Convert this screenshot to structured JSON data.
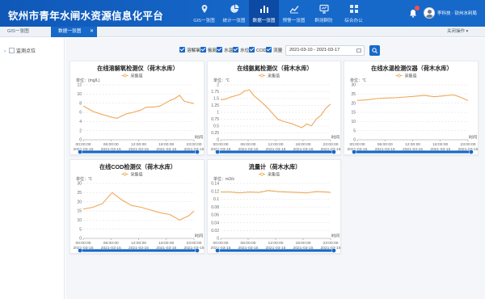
{
  "header": {
    "title": "钦州市青年水闸水资源信息化平台",
    "nav": [
      {
        "label": "GIS一张图",
        "icon": "map-pin-icon",
        "active": false
      },
      {
        "label": "统计一张图",
        "icon": "pie-chart-icon",
        "active": false
      },
      {
        "label": "数据一张图",
        "icon": "bar-chart-icon",
        "active": true
      },
      {
        "label": "预警一张图",
        "icon": "trend-line-icon",
        "active": false
      },
      {
        "label": "群测群防",
        "icon": "monitor-icon",
        "active": false
      },
      {
        "label": "综合办公",
        "icon": "grid-icon",
        "active": false
      }
    ],
    "user": "李科技 · 钦州水利局"
  },
  "tabs": [
    {
      "label": "GIS一张图",
      "active": false
    },
    {
      "label": "数据一张图",
      "active": true
    }
  ],
  "close_ops": "关闭操作 ▾",
  "sidebar": {
    "tree_label": "监测点位"
  },
  "filters": {
    "items": [
      "溶解氧",
      "氨氮",
      "水温",
      "水位",
      "COD",
      "流量"
    ],
    "date_range": "2021-03-10 - 2021-03-17"
  },
  "accent": "#1769c9",
  "series_color": "#f0a75a",
  "x_ticks": [
    "00:00:00\n2021-03-15",
    "06:00:00\n2021-03-15",
    "12:00:00\n2021-03-15",
    "18:00:00\n2021-03-15",
    "23:00:00\n2021-03-15"
  ],
  "chart_data": [
    {
      "type": "line",
      "title": "在线溶解氧检测仪（荷木水库）",
      "legend": "采集值",
      "ylabel": "单位：(mg/L)",
      "xlabel": "时间",
      "ylim": [
        0,
        12
      ],
      "yticks": [
        0,
        2,
        4,
        6,
        8,
        10,
        12
      ],
      "x": [
        0,
        2,
        4,
        6,
        7,
        9,
        10,
        12,
        13,
        15,
        16,
        17,
        18,
        19,
        20,
        21,
        23
      ],
      "y": [
        7.4,
        6.2,
        5.5,
        4.9,
        4.7,
        5.7,
        5.9,
        6.5,
        7.1,
        7.2,
        7.4,
        8.0,
        8.6,
        9.0,
        9.7,
        8.4,
        7.9
      ]
    },
    {
      "type": "line",
      "title": "在线氨氮检测仪（荷木水库）",
      "legend": "采集值",
      "ylabel": "单位：℃",
      "xlabel": "时间",
      "ylim": [
        0,
        2
      ],
      "yticks": [
        0,
        0.25,
        0.5,
        0.75,
        1,
        1.25,
        1.5,
        1.75,
        2
      ],
      "x": [
        0,
        1,
        2,
        4,
        5,
        6,
        7,
        9,
        10,
        11,
        12,
        13,
        14,
        15,
        16,
        17,
        18,
        19,
        20,
        21,
        22,
        23
      ],
      "y": [
        1.46,
        1.48,
        1.55,
        1.65,
        1.78,
        1.82,
        1.6,
        1.3,
        1.13,
        0.93,
        0.74,
        0.68,
        0.63,
        0.58,
        0.51,
        0.44,
        0.58,
        0.51,
        0.75,
        0.9,
        1.15,
        1.3
      ]
    },
    {
      "type": "line",
      "title": "在线水温检测仪器（荷木水库）",
      "legend": "采集值",
      "ylabel": "单位：℃",
      "xlabel": "时间",
      "ylim": [
        0,
        30
      ],
      "yticks": [
        0,
        5,
        10,
        15,
        20,
        25,
        30
      ],
      "x": [
        0,
        2,
        4,
        6,
        8,
        10,
        12,
        14,
        16,
        18,
        20,
        21,
        22,
        23
      ],
      "y": [
        21.5,
        21.8,
        22.5,
        22.8,
        23.0,
        23.4,
        23.8,
        24.2,
        23.5,
        24.0,
        24.5,
        23.7,
        22.6,
        21.4
      ]
    },
    {
      "type": "line",
      "title": "在线COD检测仪（荷木水库）",
      "legend": "采集值",
      "ylabel": "单位：℃",
      "xlabel": "时间",
      "ylim": [
        0,
        30
      ],
      "yticks": [
        0,
        5,
        10,
        15,
        20,
        25,
        30
      ],
      "x": [
        0,
        2,
        4,
        6,
        8,
        10,
        12,
        14,
        16,
        18,
        20,
        22,
        23
      ],
      "y": [
        16,
        17,
        19,
        25,
        21,
        18,
        17,
        15.5,
        14,
        13,
        10,
        12.5,
        15
      ]
    },
    {
      "type": "line",
      "title": "流量计（荷木水库）",
      "legend": "采集值",
      "ylabel": "单位：m3/s",
      "xlabel": "时间",
      "ylim": [
        0,
        0.14
      ],
      "yticks": [
        0,
        0.02,
        0.04,
        0.06,
        0.08,
        0.1,
        0.12,
        0.14
      ],
      "x": [
        0,
        2,
        4,
        6,
        8,
        10,
        12,
        14,
        16,
        18,
        20,
        22,
        23
      ],
      "y": [
        0.118,
        0.118,
        0.116,
        0.118,
        0.117,
        0.122,
        0.119,
        0.118,
        0.117,
        0.116,
        0.119,
        0.118,
        0.117
      ]
    }
  ]
}
